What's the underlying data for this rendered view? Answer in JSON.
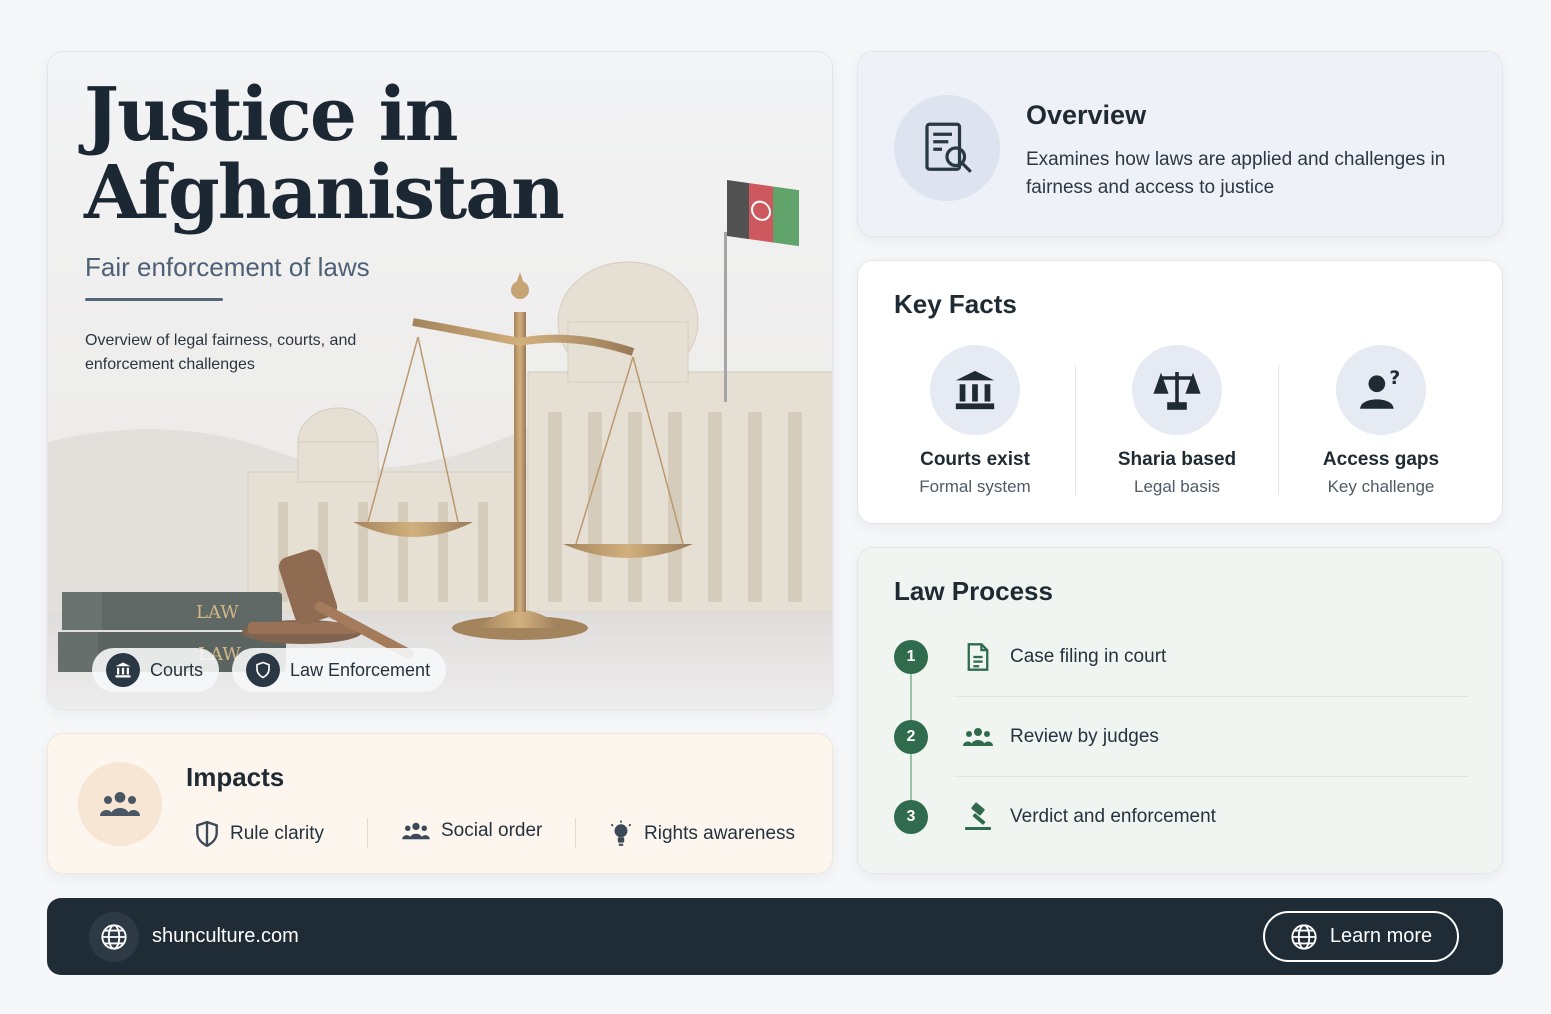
{
  "hero": {
    "title_line1": "Justice in",
    "title_line2": "Afghanistan",
    "subtitle": "Fair enforcement of laws",
    "description": "Overview of legal fairness, courts, and enforcement challenges",
    "book_label": "LAW",
    "chips": [
      {
        "label": "Courts",
        "icon": "courthouse-icon"
      },
      {
        "label": "Law Enforcement",
        "icon": "shield-icon"
      }
    ]
  },
  "overview": {
    "title": "Overview",
    "text": "Examines how laws are applied and challenges in fairness and access to justice",
    "icon": "document-search-icon"
  },
  "key_facts": {
    "title": "Key Facts",
    "items": [
      {
        "title": "Courts exist",
        "subtitle": "Formal system",
        "icon": "courthouse-icon"
      },
      {
        "title": "Sharia based",
        "subtitle": "Legal basis",
        "icon": "scales-icon"
      },
      {
        "title": "Access gaps",
        "subtitle": "Key challenge",
        "icon": "person-question-icon"
      }
    ]
  },
  "law_process": {
    "title": "Law Process",
    "steps": [
      {
        "number": "1",
        "label": "Case filing in court",
        "icon": "document-icon"
      },
      {
        "number": "2",
        "label": "Review by judges",
        "icon": "group-icon"
      },
      {
        "number": "3",
        "label": "Verdict and enforcement",
        "icon": "gavel-icon"
      }
    ]
  },
  "impacts": {
    "title": "Impacts",
    "icon": "group-icon",
    "items": [
      {
        "label": "Rule clarity",
        "icon": "shield-icon"
      },
      {
        "label": "Social order",
        "icon": "group-icon"
      },
      {
        "label": "Rights awareness",
        "icon": "lightbulb-icon"
      }
    ]
  },
  "footer": {
    "site": "shunculture.com",
    "button_label": "Learn more",
    "icon": "globe-icon"
  },
  "colors": {
    "accent_green": "#2f6b4c",
    "footer_bg": "#1f2b35",
    "title_dark": "#1b2732"
  }
}
